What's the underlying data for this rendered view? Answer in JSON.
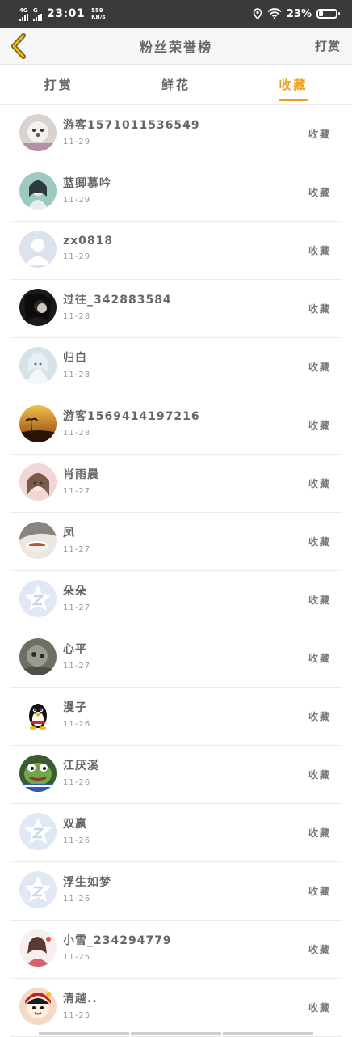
{
  "status_bar": {
    "network": "4G",
    "network2": "G",
    "time": "23:01",
    "speed_value": "559",
    "speed_unit": "KB/s",
    "battery": "23%",
    "battery_level": 0.23
  },
  "header": {
    "title": "粉丝荣誉榜",
    "right_label": "打赏"
  },
  "tabs": [
    {
      "label": "打赏",
      "active": false
    },
    {
      "label": "鲜花",
      "active": false
    },
    {
      "label": "收藏",
      "active": true
    }
  ],
  "list": [
    {
      "name": "游客1571011536549",
      "date": "11-29",
      "action": "收藏",
      "avatar": "photo-white-dog"
    },
    {
      "name": "蓝卿慕吟",
      "date": "11-29",
      "action": "收藏",
      "avatar": "photo-anime-girl"
    },
    {
      "name": "zx0818",
      "date": "11-29",
      "action": "收藏",
      "avatar": "default-person"
    },
    {
      "name": "过往_342883584",
      "date": "11-28",
      "action": "收藏",
      "avatar": "photo-dark-hair"
    },
    {
      "name": "归白",
      "date": "11-28",
      "action": "收藏",
      "avatar": "photo-anime-white"
    },
    {
      "name": "游客1569414197216",
      "date": "11-28",
      "action": "收藏",
      "avatar": "photo-sunset"
    },
    {
      "name": "肖雨晨",
      "date": "11-27",
      "action": "收藏",
      "avatar": "photo-girl"
    },
    {
      "name": "凤",
      "date": "11-27",
      "action": "收藏",
      "avatar": "photo-teacup"
    },
    {
      "name": "朵朵",
      "date": "11-27",
      "action": "收藏",
      "avatar": "default-z"
    },
    {
      "name": "心平",
      "date": "11-27",
      "action": "收藏",
      "avatar": "photo-grey-animal"
    },
    {
      "name": "漫子",
      "date": "11-26",
      "action": "收藏",
      "avatar": "penguin"
    },
    {
      "name": "江厌溪",
      "date": "11-26",
      "action": "收藏",
      "avatar": "photo-frog"
    },
    {
      "name": "双嬴",
      "date": "11-26",
      "action": "收藏",
      "avatar": "default-z"
    },
    {
      "name": "浮生如梦",
      "date": "11-26",
      "action": "收藏",
      "avatar": "default-z"
    },
    {
      "name": "小雪_234294779",
      "date": "11-25",
      "action": "收藏",
      "avatar": "photo-anime-pink"
    },
    {
      "name": "清越..",
      "date": "11-25",
      "action": "收藏",
      "avatar": "photo-cartoon-red"
    }
  ],
  "colors": {
    "accent": "#f0a020",
    "status_bar": "#3a3a3a",
    "text": "#666666",
    "divider": "#ececec"
  }
}
